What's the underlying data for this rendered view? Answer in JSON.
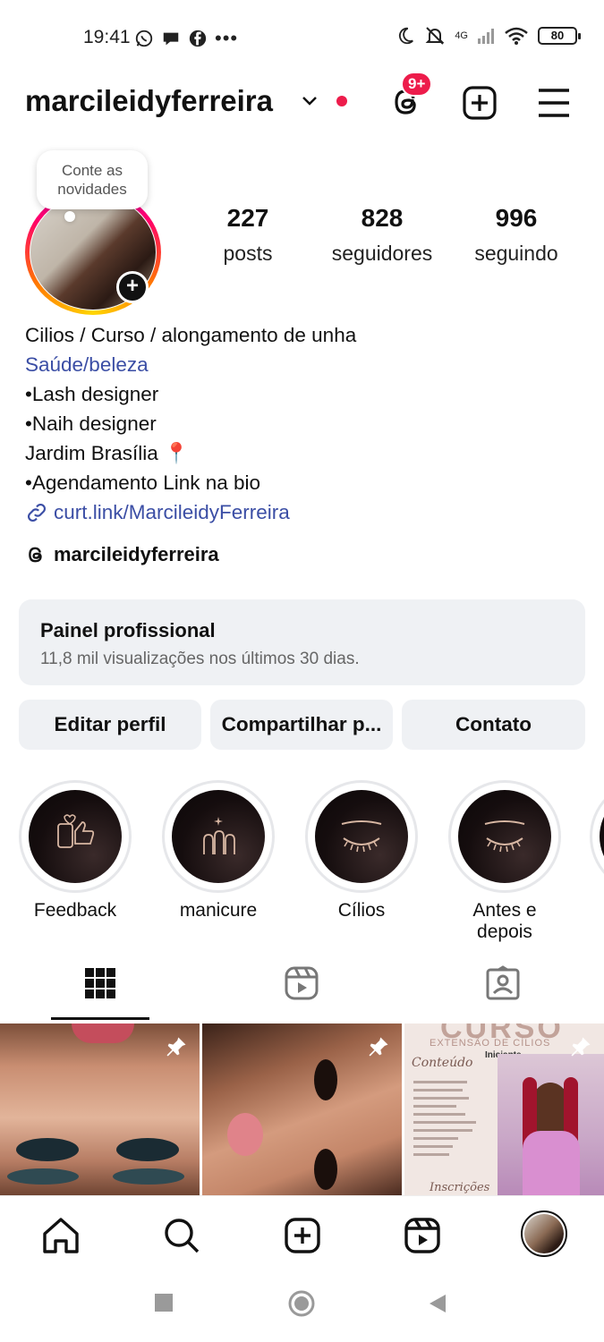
{
  "status_bar": {
    "time": "19:41",
    "dots": "•••",
    "network": "4G",
    "battery": "80"
  },
  "header": {
    "username": "marcileidyferreira",
    "threads_badge": "9+"
  },
  "profile": {
    "note": "Conte as novidades",
    "stats": [
      {
        "value": "227",
        "label": "posts"
      },
      {
        "value": "828",
        "label": "seguidores"
      },
      {
        "value": "996",
        "label": "seguindo"
      }
    ],
    "bio": {
      "name": "Cilios / Curso / alongamento de unha",
      "category": "Saúde/beleza",
      "lines": [
        "•Lash designer",
        "•Naih designer",
        "Jardim Brasília 📍",
        "•Agendamento Link na bio"
      ],
      "link": "curt.link/MarcileidyFerreira"
    },
    "threads_handle": "marcileidyferreira"
  },
  "dashboard": {
    "title": "Painel profissional",
    "subtitle": "11,8 mil visualizações nos últimos 30 dias."
  },
  "actions": {
    "edit": "Editar perfil",
    "share": "Compartilhar p...",
    "contact": "Contato"
  },
  "highlights": [
    {
      "label": "Feedback",
      "icon": "thumbs-up-phone-icon"
    },
    {
      "label": "manicure",
      "icon": "nails-icon"
    },
    {
      "label": "Cílios",
      "icon": "eyelash-icon"
    },
    {
      "label": "Antes e depois",
      "icon": "eyelash-icon"
    }
  ],
  "grid": {
    "tile3_title": "CURSO",
    "tile3_subtitle": "EXTENSÃO DE CÍLIOS",
    "tile3_level": "Iniciante",
    "tile3_heading": "Conteúdo",
    "tile3_footer": "Inscrições"
  },
  "colors": {
    "accent_link": "#3b4ea5",
    "notification_red": "#ed1c4b",
    "card_bg": "#eff1f4"
  }
}
